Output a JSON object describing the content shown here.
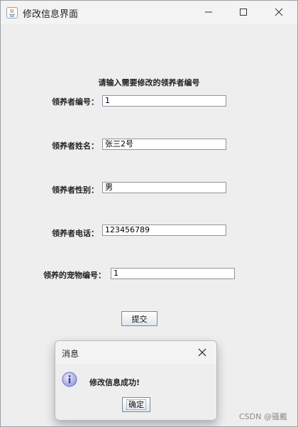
{
  "window": {
    "title": "修改信息界面"
  },
  "form": {
    "heading": "请输入需要修改的领养者编号",
    "fields": [
      {
        "label": "领养者编号：",
        "value": "1"
      },
      {
        "label": "领养者姓名：",
        "value": "张三2号"
      },
      {
        "label": "领养者性别：",
        "value": "男"
      },
      {
        "label": "领养者电话：",
        "value": "123456789"
      },
      {
        "label": "领养的宠物编号：",
        "value": "1"
      }
    ],
    "submit_label": "提交"
  },
  "dialog": {
    "title": "消息",
    "message": "修改信息成功!",
    "ok_label": "确定"
  },
  "watermark": "CSDN @骚戴",
  "icons": {
    "app": "java-icon",
    "minimize": "minimize-icon",
    "maximize": "maximize-icon",
    "close": "close-icon",
    "info": "info-icon"
  },
  "colors": {
    "window_bg": "#eeeeee",
    "titlebar_bg": "#f3f3f3",
    "input_border": "#8c96a3",
    "info_icon": "#6f73c9"
  }
}
